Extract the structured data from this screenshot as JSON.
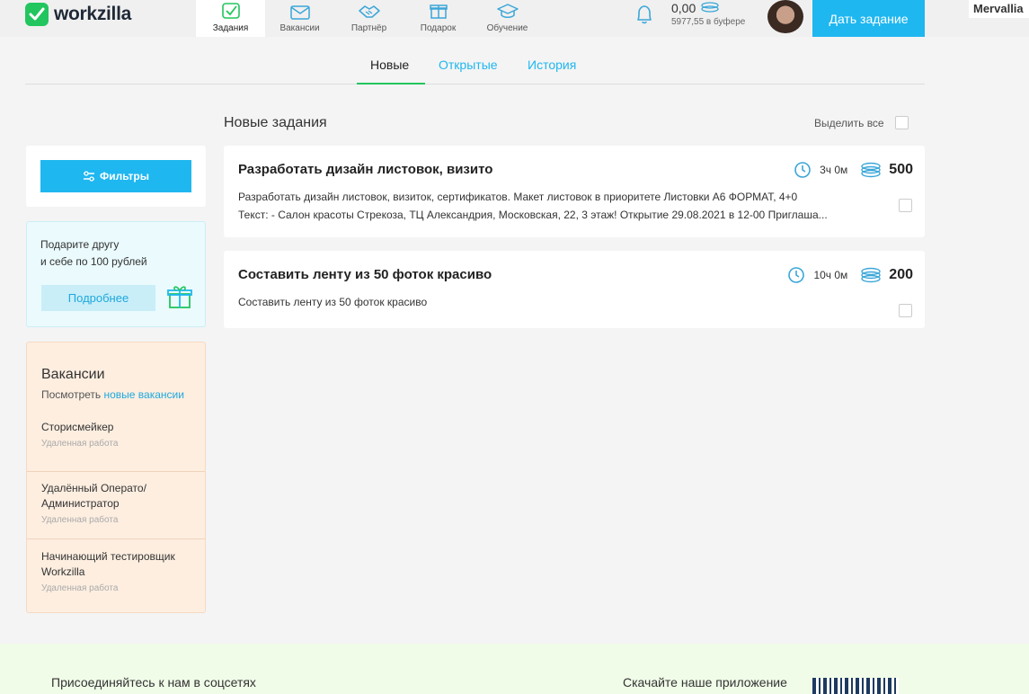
{
  "header": {
    "logo_text": "workzilla",
    "nav": [
      {
        "label": "Задания",
        "icon": "tasks-icon",
        "active": true
      },
      {
        "label": "Вакансии",
        "icon": "mail-icon",
        "active": false
      },
      {
        "label": "Партнёр",
        "icon": "handshake-icon",
        "active": false
      },
      {
        "label": "Подарок",
        "icon": "gift-icon",
        "active": false
      },
      {
        "label": "Обучение",
        "icon": "graduation-cap-icon",
        "active": false
      }
    ],
    "balance": "0,00",
    "buffer": "5977,55 в буфере",
    "give_task": "Дать задание",
    "username": "Mervallia"
  },
  "tabs": {
    "new": "Новые",
    "open": "Открытые",
    "history": "История"
  },
  "sidebar": {
    "filters_label": "Фильтры",
    "gift": {
      "line1": "Подарите другу",
      "line2": "и себе по 100 рублей",
      "button": "Подробнее"
    },
    "vacancies": {
      "title": "Вакансии",
      "sub_prefix": "Посмотреть",
      "sub_link": "новые вакансии",
      "items": [
        {
          "title": "Сторисмейкер",
          "sub": "Удаленная работа"
        },
        {
          "title": "Удалённый Операто/Администратор",
          "sub": "Удаленная работа"
        },
        {
          "title": "Начинающий тестировщик Workzilla",
          "sub": "Удаленная работа"
        }
      ]
    }
  },
  "main": {
    "title": "Новые задания",
    "select_all": "Выделить все",
    "tasks": [
      {
        "title": "Разработать дизайн листовок, визито",
        "desc_line1": "Разработать дизайн листовок, визиток, сертификатов. Макет листовок в приоритете Листовки А6 ФОРМАТ, 4+0",
        "desc_line2": "Текст: - Салон красоты Стрекоза, ТЦ Александрия, Московская, 22, 3 этаж! Открытие 29.08.2021 в 12-00 Приглаша...",
        "time": "3ч 0м",
        "price": "500"
      },
      {
        "title": "Составить ленту из 50 фоток красиво",
        "desc_line1": "Составить ленту из 50 фоток красиво",
        "desc_line2": "",
        "time": "10ч 0м",
        "price": "200"
      }
    ]
  },
  "footer": {
    "social": "Присоединяйтесь к нам в соцсетях",
    "app": "Скачайте наше приложение"
  },
  "colors": {
    "accent": "#1fb7f0",
    "brand_green": "#22c55e"
  }
}
